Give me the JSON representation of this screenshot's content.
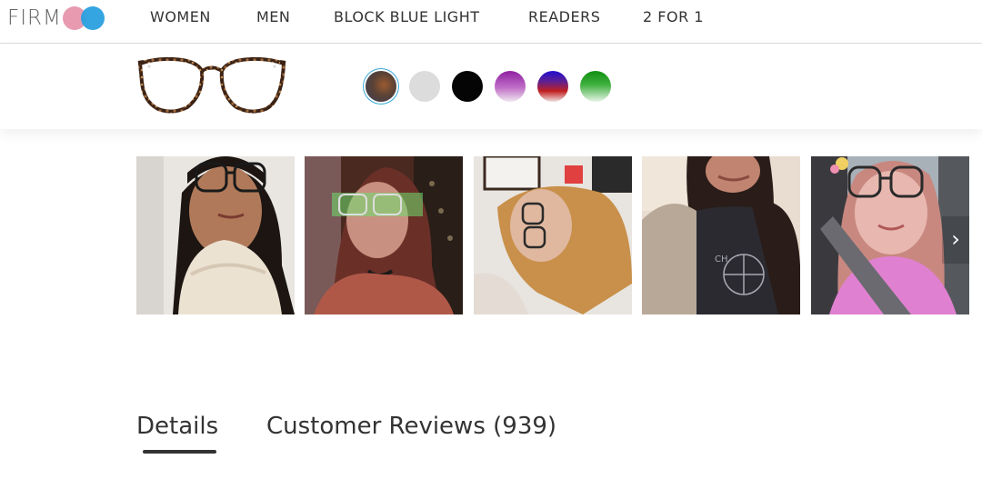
{
  "logo": {
    "text": "FIRM",
    "colors": [
      "#e79ab0",
      "#2aa0e0"
    ]
  },
  "nav": {
    "items": [
      "WOMEN",
      "MEN",
      "BLOCK BLUE LIGHT",
      "READERS",
      "2 FOR 1"
    ]
  },
  "product": {
    "frame_icon": "round-tortoise-glasses",
    "swatches": [
      {
        "name": "tortoise",
        "color": "#5a4236",
        "selected": true
      },
      {
        "name": "clear",
        "color": "#dcdcdc",
        "selected": false
      },
      {
        "name": "black",
        "color": "#050505",
        "selected": false
      },
      {
        "name": "purple-fade",
        "color": "#a040a8",
        "selected": false
      },
      {
        "name": "blue-red-fade",
        "color": "#3020c0",
        "selected": false
      },
      {
        "name": "green-fade",
        "color": "#30a030",
        "selected": false
      }
    ]
  },
  "gallery": {
    "photos": [
      "customer-photo",
      "customer-photo",
      "customer-photo",
      "customer-photo",
      "customer-photo"
    ],
    "next_icon": "chevron-right-icon",
    "next_symbol": "›"
  },
  "tabs": {
    "details": "Details",
    "reviews": "Customer Reviews (939)",
    "active": "details"
  }
}
